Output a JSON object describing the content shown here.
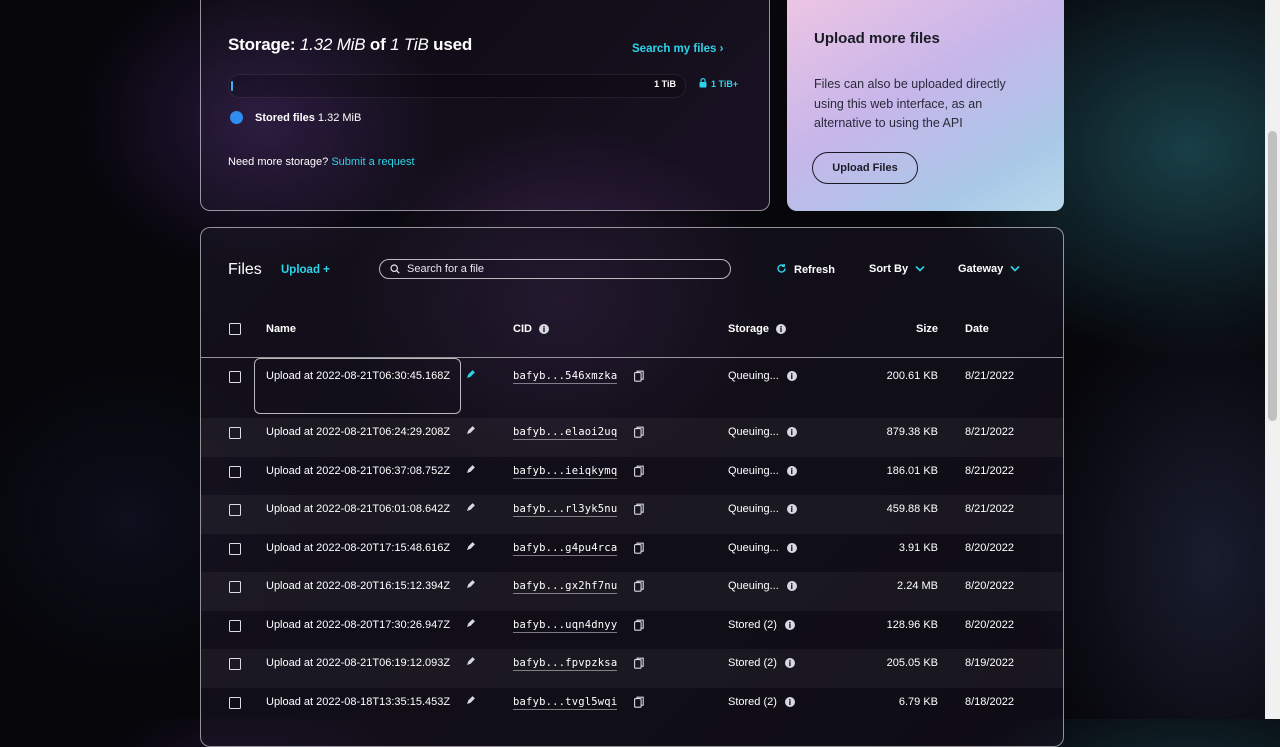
{
  "storage": {
    "title_prefix": "Storage:",
    "used": "1.32 MiB",
    "of": "of",
    "total": "1 TiB",
    "suffix": "used",
    "search_link": "Search my files",
    "bar_max_label": "1 TiB",
    "bar_upgrade_label": "1 TiB+",
    "usage_fraction": 1e-06,
    "legend_label": "Stored files",
    "legend_value": "1.32 MiB",
    "need_more_text": "Need more storage?",
    "submit_link": "Submit a request"
  },
  "upload_card": {
    "title": "Upload more files",
    "text": "Files can also be uploaded directly using this web interface, as an alternative to using the API",
    "button": "Upload Files"
  },
  "files": {
    "title": "Files",
    "upload_link": "Upload +",
    "search_placeholder": "Search for a file",
    "refresh": "Refresh",
    "sort_by": "Sort By",
    "gateway": "Gateway",
    "columns": {
      "name": "Name",
      "cid": "CID",
      "storage": "Storage",
      "size": "Size",
      "date": "Date"
    },
    "rows": [
      {
        "name": "Upload at 2022-08-21T06:30:45.168Z",
        "cid": "bafyb...546xmzka",
        "storage": "Queuing...",
        "size": "200.61 KB",
        "date": "8/21/2022"
      },
      {
        "name": "Upload at 2022-08-21T06:24:29.208Z",
        "cid": "bafyb...elaoi2uq",
        "storage": "Queuing...",
        "size": "879.38 KB",
        "date": "8/21/2022"
      },
      {
        "name": "Upload at 2022-08-21T06:37:08.752Z",
        "cid": "bafyb...ieiqkymq",
        "storage": "Queuing...",
        "size": "186.01 KB",
        "date": "8/21/2022"
      },
      {
        "name": "Upload at 2022-08-21T06:01:08.642Z",
        "cid": "bafyb...rl3yk5nu",
        "storage": "Queuing...",
        "size": "459.88 KB",
        "date": "8/21/2022"
      },
      {
        "name": "Upload at 2022-08-20T17:15:48.616Z",
        "cid": "bafyb...g4pu4rca",
        "storage": "Queuing...",
        "size": "3.91 KB",
        "date": "8/20/2022"
      },
      {
        "name": "Upload at 2022-08-20T16:15:12.394Z",
        "cid": "bafyb...gx2hf7nu",
        "storage": "Queuing...",
        "size": "2.24 MB",
        "date": "8/20/2022"
      },
      {
        "name": "Upload at 2022-08-20T17:30:26.947Z",
        "cid": "bafyb...uqn4dnyy",
        "storage": "Stored (2)",
        "size": "128.96 KB",
        "date": "8/20/2022"
      },
      {
        "name": "Upload at 2022-08-21T06:19:12.093Z",
        "cid": "bafyb...fpvpzksa",
        "storage": "Stored (2)",
        "size": "205.05 KB",
        "date": "8/19/2022"
      },
      {
        "name": "Upload at 2022-08-18T13:35:15.453Z",
        "cid": "bafyb...tvgl5wqi",
        "storage": "Stored (2)",
        "size": "6.79 KB",
        "date": "8/18/2022"
      }
    ]
  },
  "colors": {
    "accent": "#2dd4e8",
    "legend_dot": "#2f8df0"
  }
}
